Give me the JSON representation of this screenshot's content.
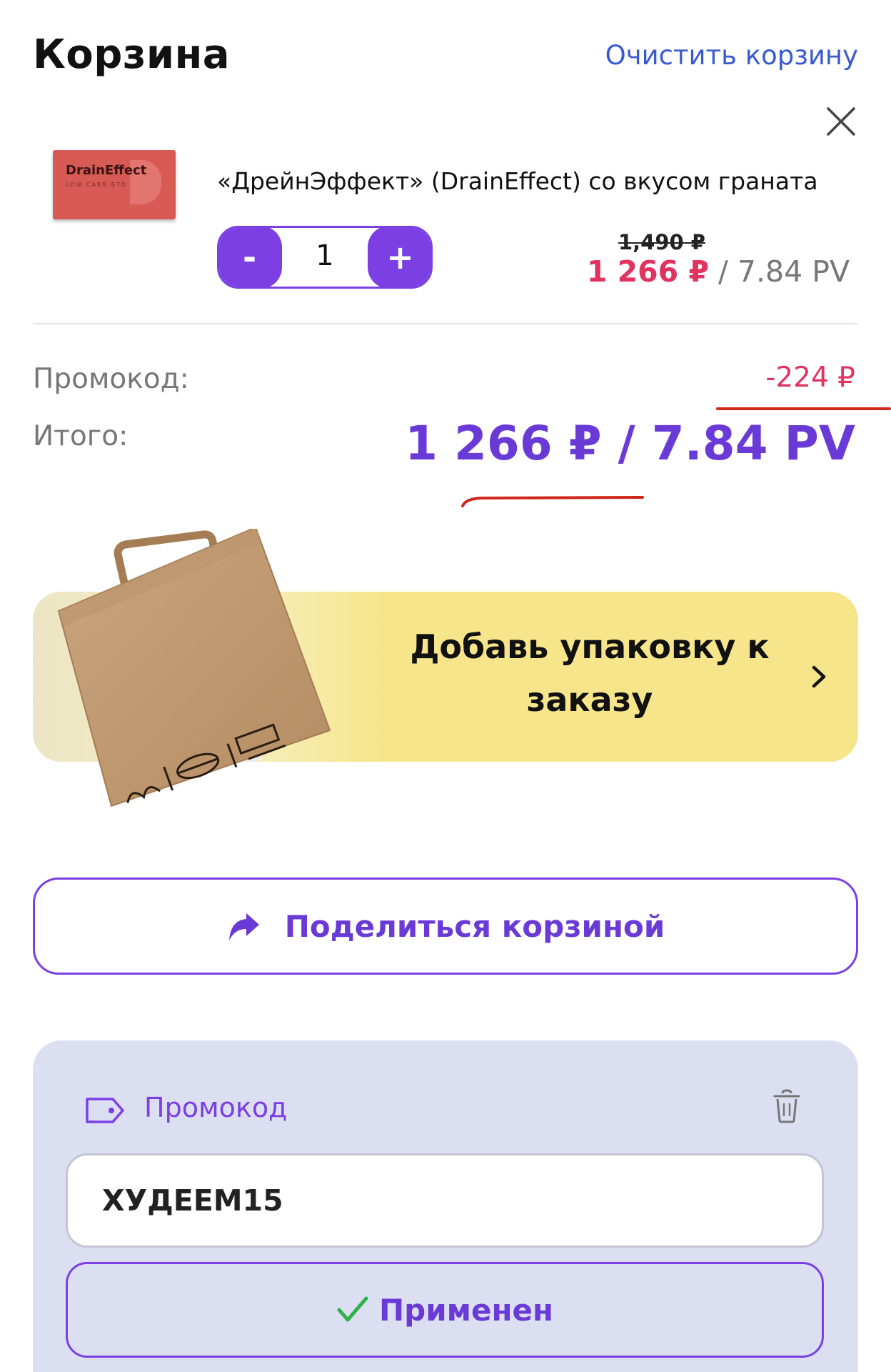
{
  "header": {
    "title": "Корзина",
    "clear_link": "Очистить корзину"
  },
  "item": {
    "thumb_brand": "DrainEffect",
    "thumb_sub": "LOW CARB BTD",
    "name": "«ДрейнЭффект» (DrainEffect) со вкусом граната",
    "minus_label": "-",
    "plus_label": "+",
    "quantity": "1",
    "old_price": "1,490 ₽",
    "new_price": "1 266 ₽",
    "price_sep": " / ",
    "pv": "7.84 PV"
  },
  "summary": {
    "promo_label": "Промокод:",
    "promo_discount": "-224 ₽",
    "total_label": "Итого:",
    "total_value": "1 266 ₽ / 7.84 PV"
  },
  "banner": {
    "text": "Добавь упаковку к заказу"
  },
  "share": {
    "label": "Поделиться корзиной"
  },
  "promo_panel": {
    "label": "Промокод",
    "code_value": "ХУДЕЕМ15",
    "apply_label": "Применен"
  },
  "colors": {
    "accent": "#7b3fe4",
    "price_red": "#e0335f",
    "banner_yellow": "#f6e58b",
    "panel_bg": "#dcdff2",
    "annotation_red": "#d1261b"
  },
  "icons": [
    "close-icon",
    "share-arrow-icon",
    "promo-tag-icon",
    "trash-icon",
    "check-icon",
    "chevron-right-icon"
  ]
}
